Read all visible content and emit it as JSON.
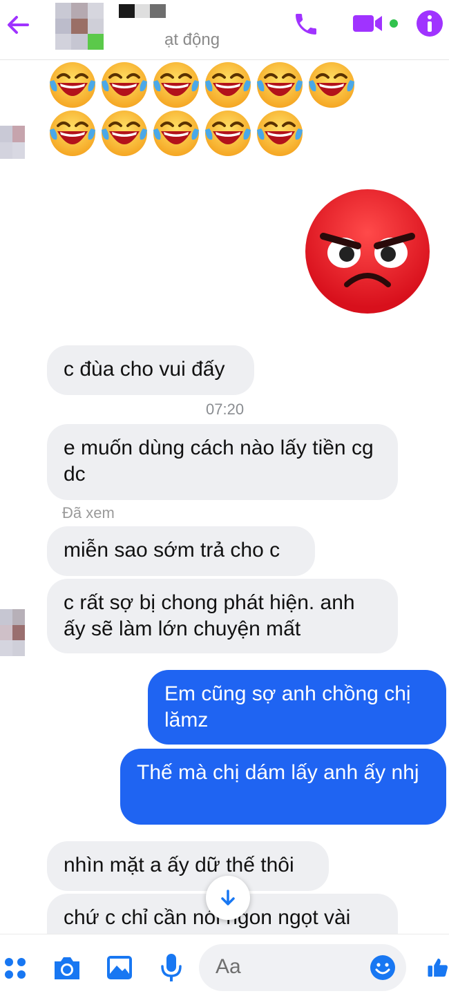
{
  "header": {
    "status": "ạt động"
  },
  "messages": [
    {
      "id": "m1",
      "text": "c đùa cho vui đấy"
    },
    {
      "id": "m2",
      "text": "e muốn dùng cách nào lấy tiền cg dc"
    },
    {
      "id": "m3",
      "text": "miễn sao sớm trả cho c"
    },
    {
      "id": "m4",
      "text": "c rất sợ bị chong phát hiện. anh ấy sẽ làm lớn chuyện mất"
    },
    {
      "id": "m5",
      "text": "Em cũng sợ anh chồng chị lămz"
    },
    {
      "id": "m6",
      "text": "Thế mà chị dám lấy anh ấy nhj"
    },
    {
      "id": "m7",
      "text": "nhìn mặt a ấy dữ thế thôi"
    },
    {
      "id": "m8",
      "text": "chứ c chỉ cần nói ngon ngọt vài"
    }
  ],
  "timestamp": "07:20",
  "seen_label": "Đã xem",
  "composer": {
    "placeholder": "Aa"
  },
  "icons": {
    "back": "back-arrow-icon",
    "call": "phone-icon",
    "video": "video-camera-icon",
    "info": "info-icon",
    "apps": "apps-grid-icon",
    "camera": "camera-icon",
    "gallery": "image-icon",
    "mic": "microphone-icon",
    "emoji": "emoji-icon",
    "like": "thumbs-up-icon",
    "scroll": "arrow-down-icon"
  },
  "colors": {
    "accent": "#a033ff",
    "incoming_bubble": "#eeeff2",
    "outgoing_bubble": "#1f64f2",
    "composer_icons": "#1877f2",
    "online_dot": "#31c24d"
  },
  "stickers": {
    "laugh_count_row1": 6,
    "laugh_count_row2": 5
  }
}
